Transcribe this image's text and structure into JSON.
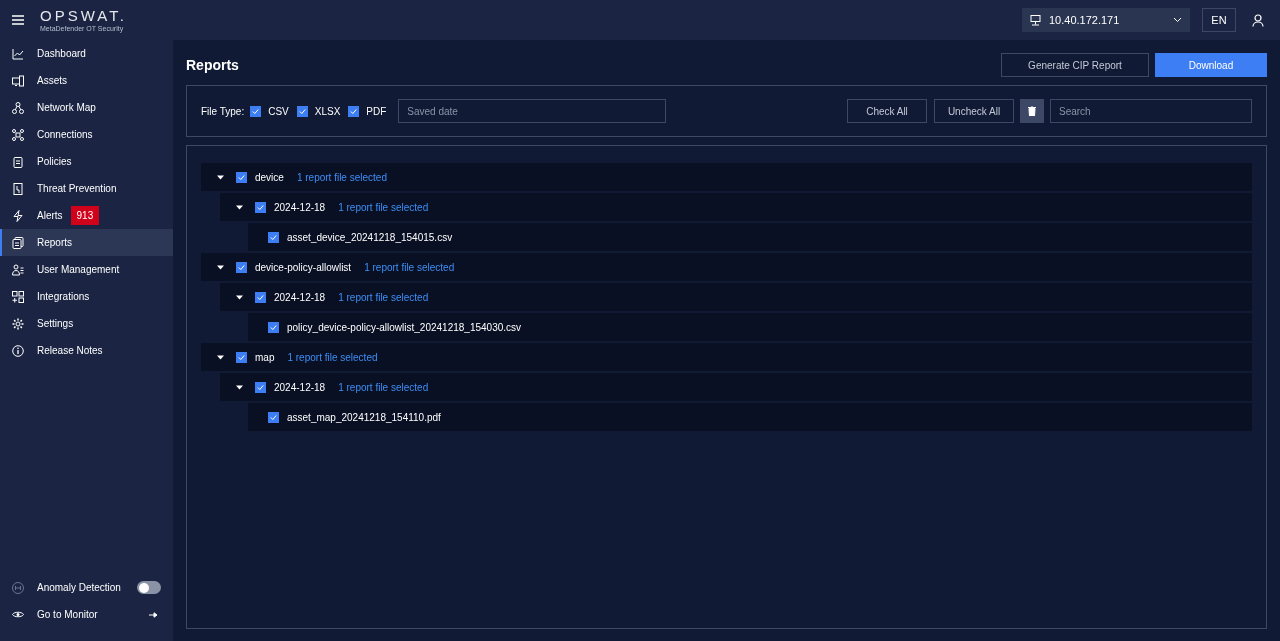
{
  "header": {
    "brand": "OPSWAT.",
    "product": "MetaDefender OT Security",
    "device": "10.40.172.171",
    "language": "EN"
  },
  "sidebar": {
    "items": [
      {
        "label": "Dashboard",
        "selected": false
      },
      {
        "label": "Assets",
        "selected": false
      },
      {
        "label": "Network Map",
        "selected": false
      },
      {
        "label": "Connections",
        "selected": false
      },
      {
        "label": "Policies",
        "selected": false
      },
      {
        "label": "Threat Prevention",
        "selected": false
      },
      {
        "label": "Alerts",
        "selected": false,
        "badge": "913"
      },
      {
        "label": "Reports",
        "selected": true
      },
      {
        "label": "User Management",
        "selected": false
      },
      {
        "label": "Integrations",
        "selected": false
      },
      {
        "label": "Settings",
        "selected": false
      },
      {
        "label": "Release Notes",
        "selected": false
      }
    ],
    "anomaly": {
      "label": "Anomaly Detection",
      "on": false
    },
    "monitor": {
      "label": "Go to Monitor"
    }
  },
  "page": {
    "title": "Reports",
    "buttons": [
      "Generate CIP Report",
      "Download"
    ]
  },
  "filter": {
    "label": "File Type:",
    "types": [
      {
        "label": "CSV",
        "checked": true
      },
      {
        "label": "XLSX",
        "checked": true
      },
      {
        "label": "PDF",
        "checked": true
      }
    ],
    "date_placeholder": "Saved date",
    "check_all": "Check All",
    "uncheck_all": "Uncheck All",
    "search_placeholder": "Search"
  },
  "tree": [
    {
      "label": "device",
      "summary": "1 report file selected",
      "checked": true,
      "expanded": true,
      "children": [
        {
          "label": "2024-12-18",
          "summary": "1 report file selected",
          "checked": true,
          "expanded": true,
          "children": [
            {
              "label": "asset_device_20241218_154015.csv",
              "checked": true
            }
          ]
        }
      ]
    },
    {
      "label": "device-policy-allowlist",
      "summary": "1 report file selected",
      "checked": true,
      "expanded": true,
      "children": [
        {
          "label": "2024-12-18",
          "summary": "1 report file selected",
          "checked": true,
          "expanded": true,
          "children": [
            {
              "label": "policy_device-policy-allowlist_20241218_154030.csv",
              "checked": true
            }
          ]
        }
      ]
    },
    {
      "label": "map",
      "summary": "1 report file selected",
      "checked": true,
      "expanded": true,
      "children": [
        {
          "label": "2024-12-18",
          "summary": "1 report file selected",
          "checked": true,
          "expanded": true,
          "children": [
            {
              "label": "asset_map_20241218_154110.pdf",
              "checked": true
            }
          ]
        }
      ]
    }
  ]
}
